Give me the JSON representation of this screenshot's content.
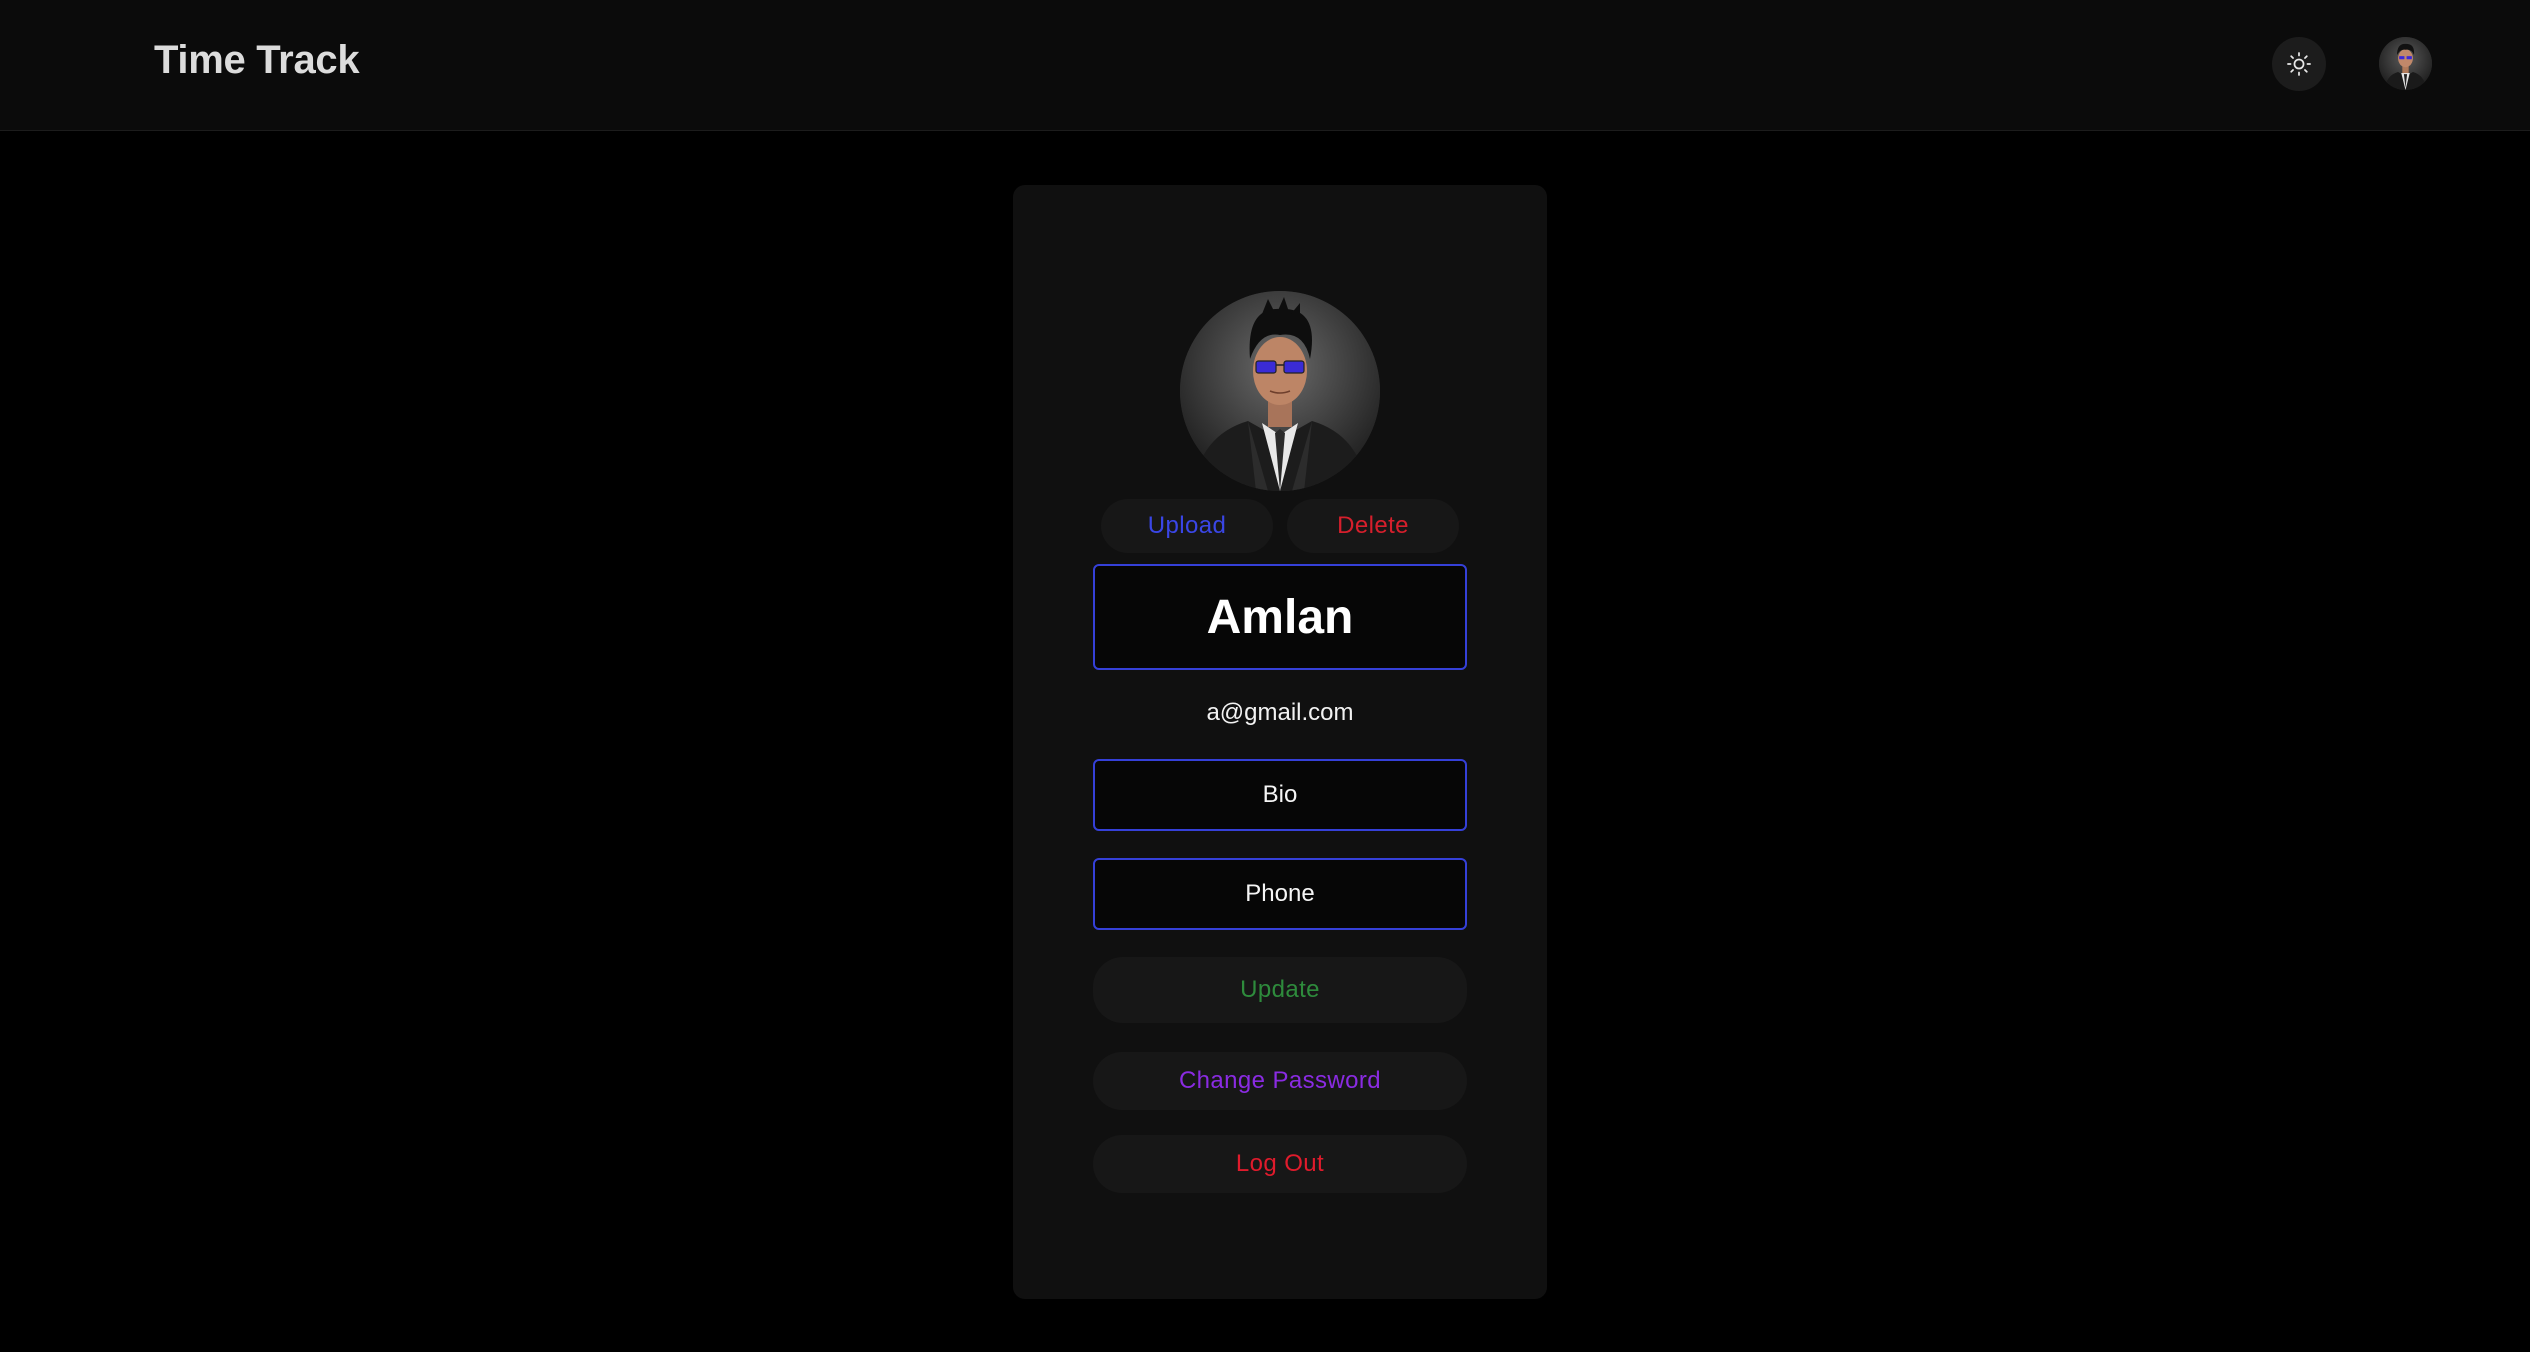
{
  "header": {
    "brand": "Time Track",
    "theme_toggle_icon": "sun-icon",
    "avatar_icon": "user-avatar"
  },
  "profile": {
    "name": "Amlan",
    "email": "a@gmail.com",
    "upload_label": "Upload",
    "delete_label": "Delete",
    "bio_placeholder": "Bio",
    "phone_placeholder": "Phone",
    "update_label": "Update",
    "change_password_label": "Change Password",
    "logout_label": "Log Out"
  },
  "colors": {
    "accent_blue": "#3540d8",
    "upload": "#3a46e6",
    "delete": "#d61f2c",
    "update": "#2e8b3c",
    "change_password": "#8a2be2",
    "logout": "#e01b2c"
  }
}
